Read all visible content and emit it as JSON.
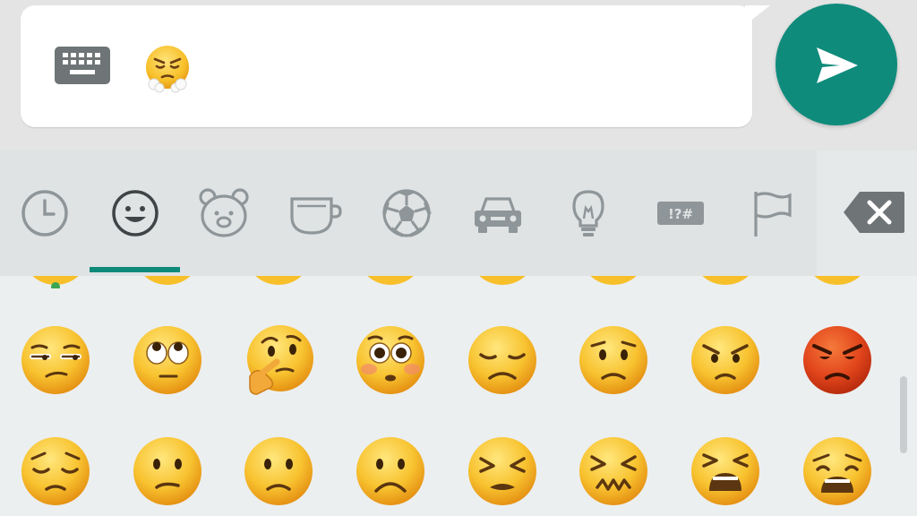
{
  "input": {
    "typed_emoji": "face-with-steam-from-nose",
    "keyboard_icon": "keyboard-icon",
    "send_icon": "send-icon"
  },
  "tabs": [
    {
      "name": "recent",
      "icon": "clock-icon"
    },
    {
      "name": "smileys",
      "icon": "smiley-icon",
      "selected": true
    },
    {
      "name": "animals",
      "icon": "bear-icon"
    },
    {
      "name": "food",
      "icon": "cup-icon"
    },
    {
      "name": "activity",
      "icon": "soccer-ball-icon"
    },
    {
      "name": "travel",
      "icon": "car-icon"
    },
    {
      "name": "objects",
      "icon": "lightbulb-icon"
    },
    {
      "name": "symbols",
      "icon": "symbols-icon",
      "label": "!?#"
    },
    {
      "name": "flags",
      "icon": "flag-icon"
    }
  ],
  "backspace_icon": "backspace-icon",
  "emoji_rows": [
    [
      "unamused-face",
      "face-with-rolling-eyes",
      "thinking-face",
      "flushed-face",
      "disappointed-face",
      "worried-face",
      "angry-face",
      "pouting-face"
    ],
    [
      "pensive-face",
      "confused-face",
      "slightly-frowning-face",
      "frowning-face",
      "persevering-face",
      "confounded-face",
      "tired-face",
      "weary-face"
    ]
  ],
  "colors": {
    "accent": "#0f8b7c",
    "emoji_yellow": "#f7c02a",
    "emoji_red": "#e2461c",
    "icon_gray": "#8f9699"
  }
}
